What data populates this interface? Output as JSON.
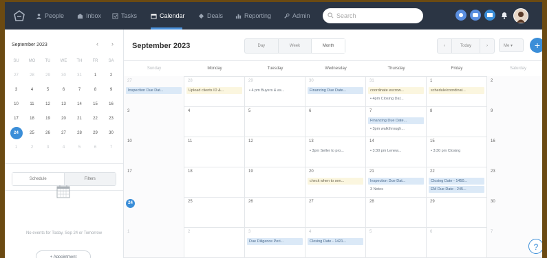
{
  "nav": {
    "items": [
      {
        "label": "People",
        "icon": "people-icon"
      },
      {
        "label": "Inbox",
        "icon": "inbox-icon"
      },
      {
        "label": "Tasks",
        "icon": "tasks-icon"
      },
      {
        "label": "Calendar",
        "icon": "calendar-icon"
      },
      {
        "label": "Deals",
        "icon": "deals-icon"
      },
      {
        "label": "Reporting",
        "icon": "reporting-icon"
      },
      {
        "label": "Admin",
        "icon": "admin-icon"
      }
    ],
    "active": "Calendar",
    "search_placeholder": "Search",
    "colors": {
      "bar": "#2b3544",
      "accent": "#3b8ed8"
    }
  },
  "sidebar": {
    "month_title": "September 2023",
    "dow": [
      "SU",
      "MO",
      "TU",
      "WE",
      "TH",
      "FR",
      "SA"
    ],
    "weeks": [
      [
        "27",
        "28",
        "29",
        "30",
        "31",
        "1",
        "2"
      ],
      [
        "3",
        "4",
        "5",
        "6",
        "7",
        "8",
        "9"
      ],
      [
        "10",
        "11",
        "12",
        "13",
        "14",
        "15",
        "16"
      ],
      [
        "17",
        "18",
        "19",
        "20",
        "21",
        "22",
        "23"
      ],
      [
        "24",
        "25",
        "26",
        "27",
        "28",
        "29",
        "30"
      ],
      [
        "1",
        "2",
        "3",
        "4",
        "5",
        "6",
        "7"
      ]
    ],
    "today": "24",
    "tabs": [
      "Schedule",
      "Filters"
    ],
    "empty_text": "No events for Today, Sep 24 or Tomorrow",
    "appointment_button": "+ Appointment"
  },
  "main": {
    "title": "September 2023",
    "views": [
      "Day",
      "Week",
      "Month"
    ],
    "today_button": "Today",
    "filter_label": "Me",
    "add_button": "+",
    "help_button": "?",
    "dow": [
      "Sunday",
      "Monday",
      "Tuesday",
      "Wednesday",
      "Thursday",
      "Friday",
      "Saturday"
    ],
    "weeks": [
      {
        "days": [
          {
            "num": "27",
            "muted": true,
            "events": [
              {
                "text": "Inspection Due Dat...",
                "style": "blue"
              }
            ]
          },
          {
            "num": "28",
            "muted": true,
            "events": [
              {
                "text": "Upload clients ID &...",
                "style": "yellow"
              }
            ]
          },
          {
            "num": "29",
            "muted": true,
            "events": [
              {
                "text": "• 4 pm Buyers & as...",
                "style": "plain"
              }
            ]
          },
          {
            "num": "30",
            "muted": true,
            "events": [
              {
                "text": "Financing Due Date...",
                "style": "blue"
              }
            ]
          },
          {
            "num": "31",
            "muted": true,
            "events": [
              {
                "text": "coordinate escrow...",
                "style": "yellow"
              },
              {
                "text": "• 4pm Closing Dat...",
                "style": "plain"
              }
            ]
          },
          {
            "num": "1",
            "events": [
              {
                "text": "schedule/coordinat...",
                "style": "yellow"
              }
            ]
          },
          {
            "num": "2",
            "events": []
          }
        ]
      },
      {
        "days": [
          {
            "num": "3",
            "events": []
          },
          {
            "num": "4",
            "events": []
          },
          {
            "num": "5",
            "events": []
          },
          {
            "num": "6",
            "events": []
          },
          {
            "num": "7",
            "events": [
              {
                "text": "Financing Due Date...",
                "style": "blue"
              },
              {
                "text": "• 3pm walkthrough...",
                "style": "plain"
              }
            ]
          },
          {
            "num": "8",
            "events": []
          },
          {
            "num": "9",
            "events": []
          }
        ]
      },
      {
        "days": [
          {
            "num": "10",
            "events": []
          },
          {
            "num": "11",
            "events": []
          },
          {
            "num": "12",
            "events": []
          },
          {
            "num": "13",
            "events": [
              {
                "text": "• 3pm Seller to pro...",
                "style": "plain"
              }
            ]
          },
          {
            "num": "14",
            "events": [
              {
                "text": "• 3:30 pm Lenew...",
                "style": "plain"
              }
            ]
          },
          {
            "num": "15",
            "events": [
              {
                "text": "• 3:30 pm Closing",
                "style": "plain"
              }
            ]
          },
          {
            "num": "16",
            "events": []
          }
        ]
      },
      {
        "days": [
          {
            "num": "17",
            "events": []
          },
          {
            "num": "18",
            "events": []
          },
          {
            "num": "19",
            "events": []
          },
          {
            "num": "20",
            "events": [
              {
                "text": "check when to sen...",
                "style": "yellow"
              }
            ]
          },
          {
            "num": "21",
            "events": [
              {
                "text": "Inspection Due Dat...",
                "style": "blue"
              },
              {
                "text": "3 Notes",
                "style": "plain"
              }
            ]
          },
          {
            "num": "22",
            "events": [
              {
                "text": "Closing Date - 1450...",
                "style": "blue"
              },
              {
                "text": "EM Due Date - 245...",
                "style": "blue"
              }
            ]
          },
          {
            "num": "23",
            "events": []
          }
        ]
      },
      {
        "days": [
          {
            "num": "24",
            "today": true,
            "events": []
          },
          {
            "num": "25",
            "events": []
          },
          {
            "num": "26",
            "events": []
          },
          {
            "num": "27",
            "events": []
          },
          {
            "num": "28",
            "events": []
          },
          {
            "num": "29",
            "events": []
          },
          {
            "num": "30",
            "events": []
          }
        ]
      },
      {
        "days": [
          {
            "num": "1",
            "muted": true,
            "events": []
          },
          {
            "num": "2",
            "muted": true,
            "events": []
          },
          {
            "num": "3",
            "muted": true,
            "events": [
              {
                "text": "Due Diligence Peri...",
                "style": "blue"
              }
            ]
          },
          {
            "num": "4",
            "muted": true,
            "events": [
              {
                "text": "Closing Date - 1421...",
                "style": "blue"
              }
            ]
          },
          {
            "num": "5",
            "muted": true,
            "events": []
          },
          {
            "num": "6",
            "muted": true,
            "events": []
          },
          {
            "num": "7",
            "muted": true,
            "events": []
          }
        ]
      }
    ]
  }
}
